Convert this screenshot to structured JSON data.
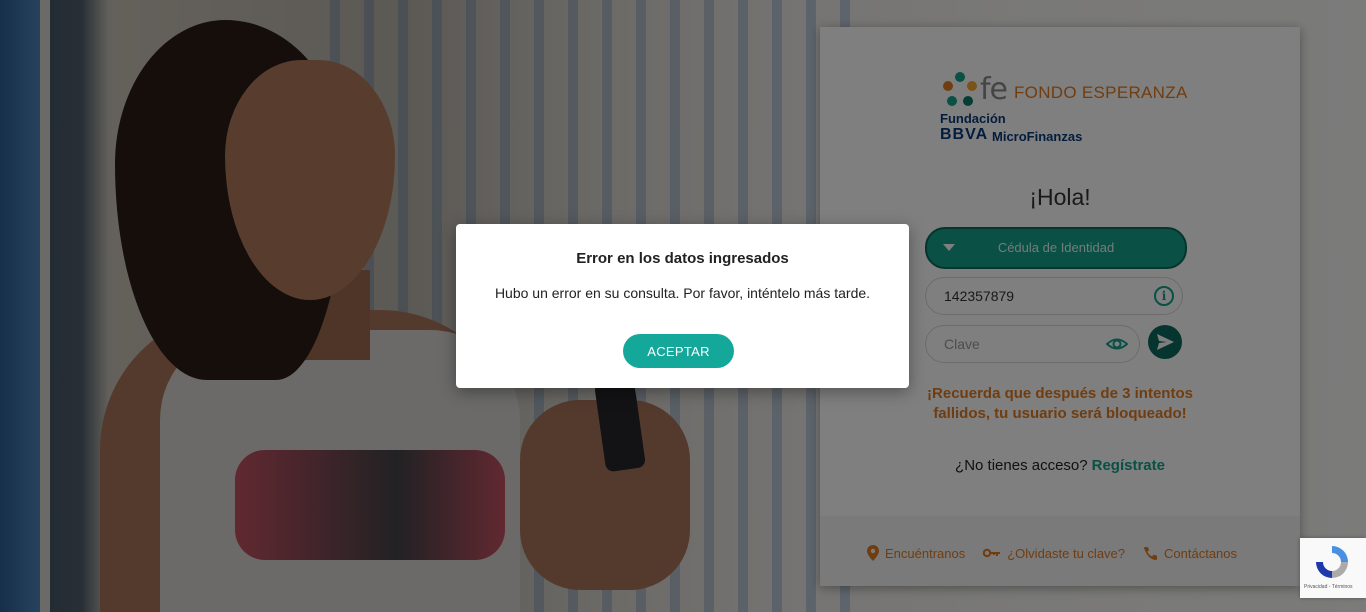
{
  "brand": {
    "logo_mark": "fe",
    "name": "FONDO ESPERANZA",
    "foundation": "Fundación",
    "bbva": "BBVA",
    "microfinanzas": "MicroFinanzas",
    "accent_orange": "#e07b22",
    "accent_teal": "#14a08a",
    "navy": "#0a3a7a"
  },
  "login": {
    "greeting": "¡Hola!",
    "document_type": {
      "selected": "Cédula de Identidad",
      "icon": "caret-down-icon"
    },
    "id_field": {
      "value": "142357879",
      "icon": "info-icon"
    },
    "password_field": {
      "placeholder": "Clave",
      "icon": "eye-icon"
    },
    "submit_icon": "send-icon",
    "warning": "¡Recuerda que después de 3 intentos fallidos, tu usuario será bloqueado!",
    "no_access": "¿No tienes acceso?",
    "register_link": "Regístrate"
  },
  "footer_links": [
    {
      "label": "Encuéntranos",
      "icon": "location-pin-icon"
    },
    {
      "label": "¿Olvidaste tu clave?",
      "icon": "key-icon"
    },
    {
      "label": "Contáctanos",
      "icon": "phone-icon"
    }
  ],
  "recaptcha": {
    "text": "Privacidad - Términos"
  },
  "modal": {
    "title": "Error en los datos ingresados",
    "message": "Hubo un error en su consulta. Por favor, inténtelo más tarde.",
    "button": "ACEPTAR"
  }
}
